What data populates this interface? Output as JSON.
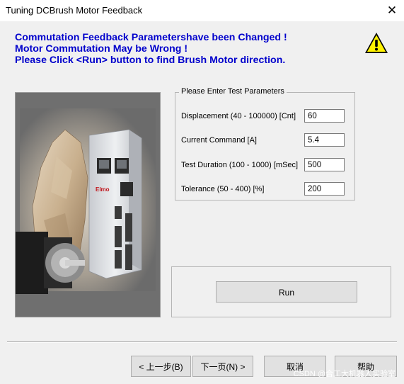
{
  "window": {
    "title": "Tuning DCBrush Motor Feedback",
    "close_glyph": "✕"
  },
  "message": {
    "line1": "Commutation Feedback Parametershave been Changed !",
    "line2": "Motor Commutation May be Wrong !",
    "line3": "Please Click <Run> button to find Brush Motor direction.",
    "color": "#0000cc"
  },
  "warning_icon": "warning-triangle-icon",
  "image": {
    "brand_text": "Elmo",
    "subject": "drive-and-motor-photo"
  },
  "test_parameters": {
    "legend": "Please Enter Test Parameters",
    "fields": [
      {
        "label": "Displacement   (40 - 100000)  [Cnt]",
        "value": "60"
      },
      {
        "label": "Current Command [A]",
        "value": "5.4"
      },
      {
        "label": "Test Duration (100 - 1000) [mSec]",
        "value": "500"
      },
      {
        "label": "Tolerance  (50 - 400)  [%]",
        "value": "200"
      }
    ]
  },
  "run_button": {
    "label": "Run"
  },
  "nav": {
    "back_label": "< 上一步(B)",
    "next_label": "下一页(N) >",
    "cancel_label": "取消",
    "help_label": "帮助"
  },
  "watermark": "CSDN @合工大机器人实验室"
}
